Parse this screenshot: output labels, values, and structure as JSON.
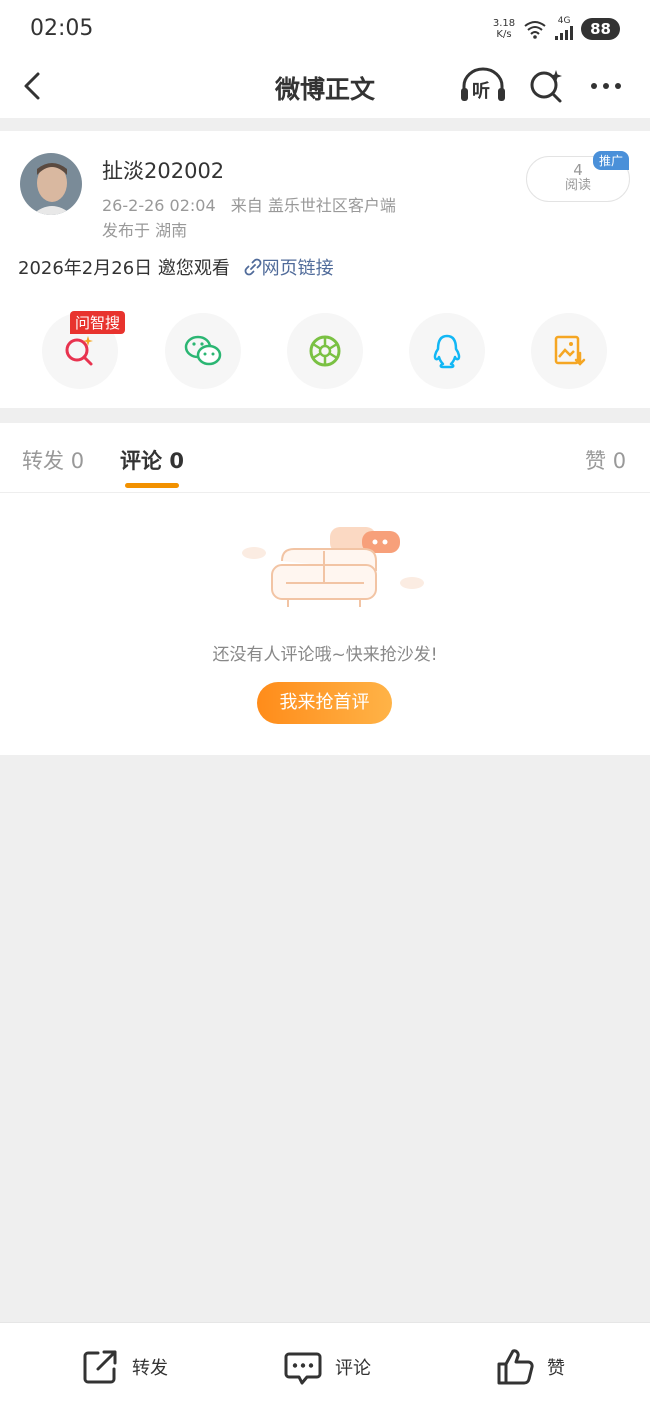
{
  "status_bar": {
    "time": "02:05",
    "net_speed_value": "3.18",
    "net_speed_unit": "K/s",
    "signal": "4G",
    "battery": "88"
  },
  "nav": {
    "title": "微博正文",
    "listen_label": "听",
    "back_icon": "back-arrow-icon",
    "search_icon": "sparkle-search-icon",
    "more_icon": "more-dots-icon"
  },
  "post": {
    "username": "扯淡202002",
    "datetime": "26-2-26 02:04",
    "source": "来自 盖乐世社区客户端",
    "location": "发布于 湖南",
    "read_count": "4",
    "read_label": "阅读",
    "promo_tag": "推广",
    "content": "2026年2月26日 邀您观看",
    "link_text": "网页链接"
  },
  "share": {
    "ask_tag": "问智搜",
    "items": [
      "ask-search-icon",
      "wechat-icon",
      "moments-icon",
      "qq-icon",
      "save-image-icon"
    ]
  },
  "tabs": {
    "repost_label": "转发",
    "repost_count": "0",
    "comment_label": "评论",
    "comment_count": "0",
    "like_label": "赞",
    "like_count": "0"
  },
  "empty_state": {
    "message": "还没有人评论哦~快来抢沙发!",
    "button_label": "我来抢首评"
  },
  "bottom_bar": {
    "repost": "转发",
    "comment": "评论",
    "like": "赞"
  },
  "colors": {
    "accent": "#f29100",
    "link": "#506b9a",
    "promo": "#4a90d9",
    "ask_tag": "#e8332e"
  }
}
